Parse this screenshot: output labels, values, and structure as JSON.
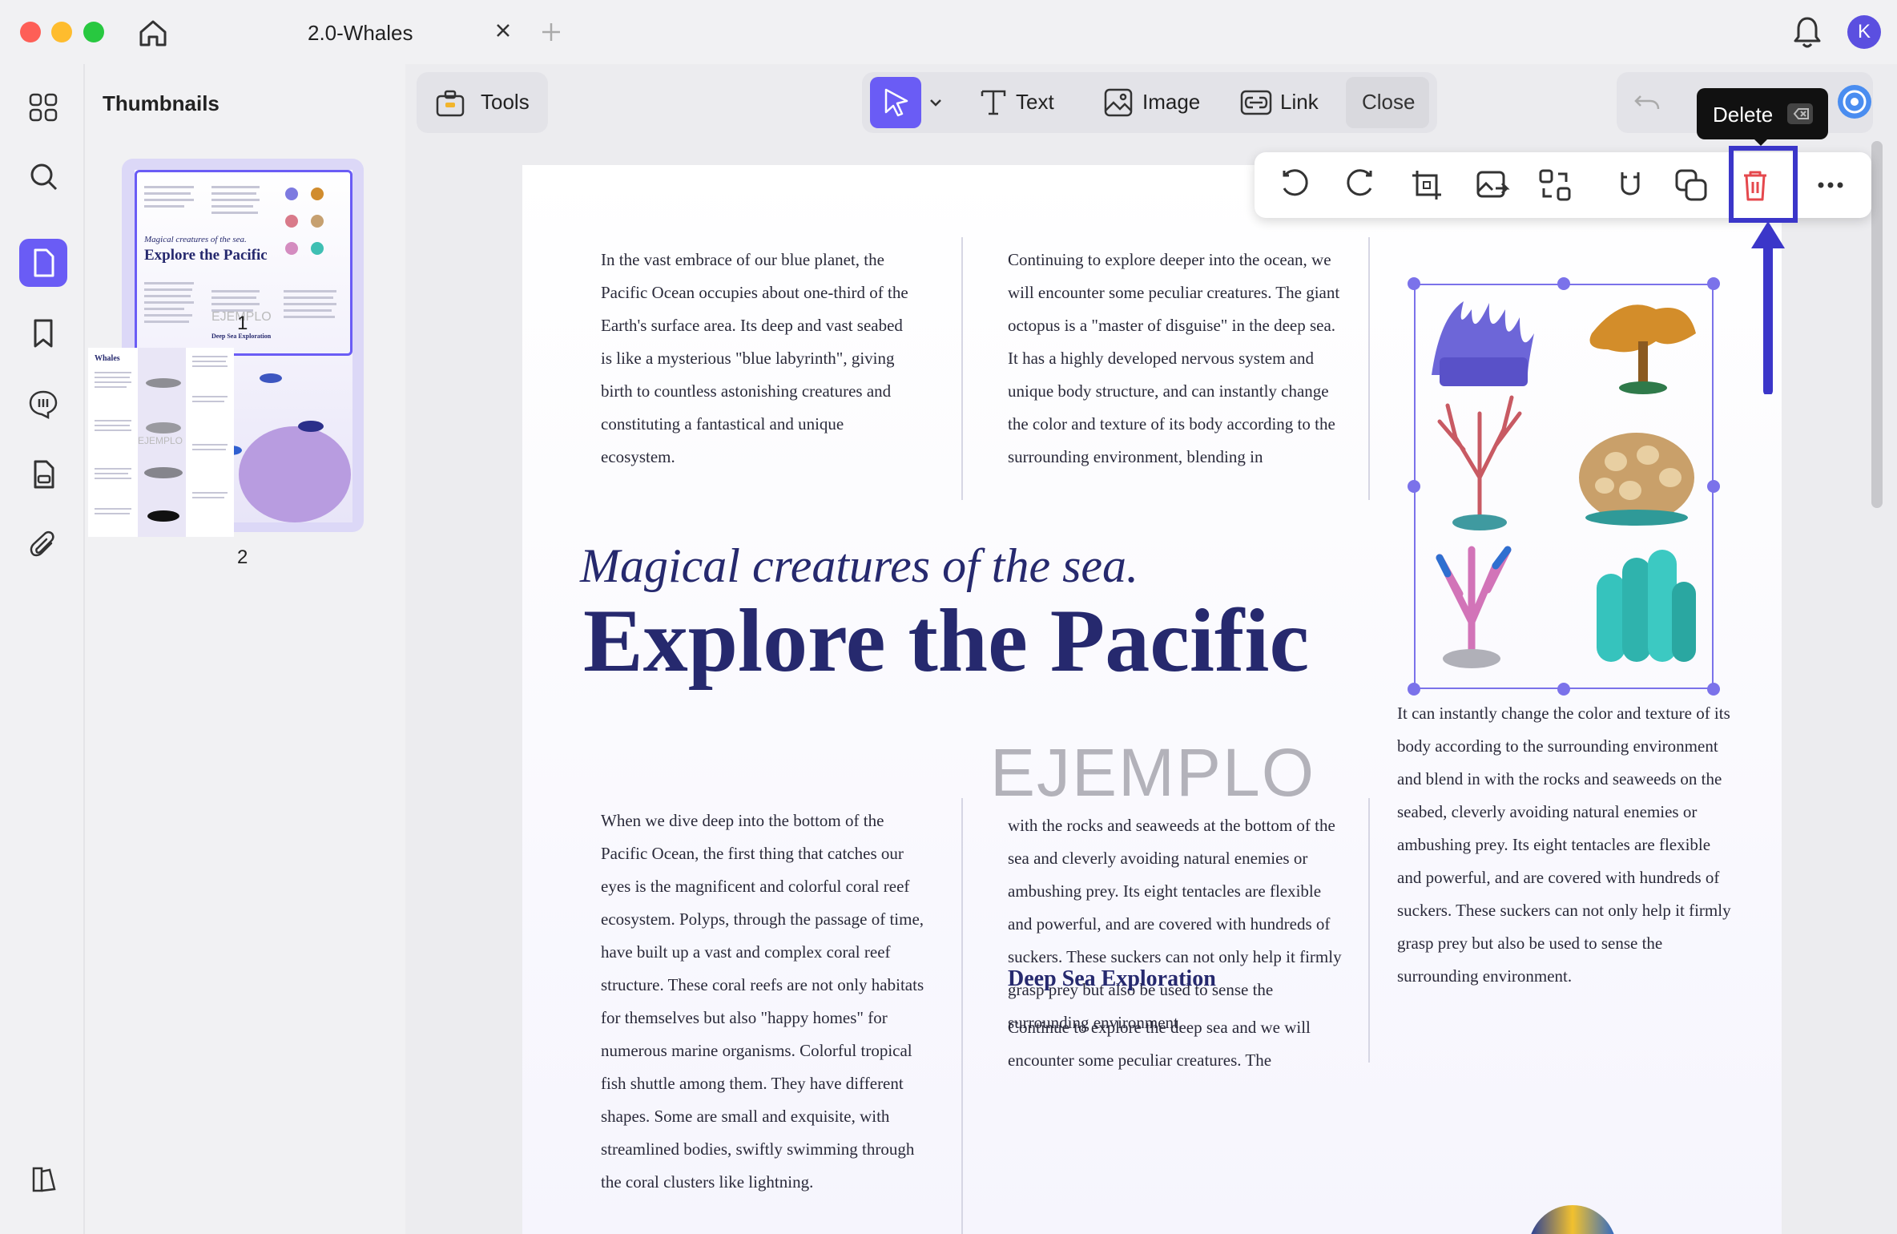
{
  "tab": {
    "title": "2.0-Whales"
  },
  "user": {
    "initial": "K"
  },
  "panel": {
    "title": "Thumbnails",
    "pages": [
      "1",
      "2"
    ]
  },
  "toolbar": {
    "tools_label": "Tools",
    "text_label": "Text",
    "image_label": "Image",
    "link_label": "Link",
    "close_label": "Close"
  },
  "tooltip": {
    "label": "Delete"
  },
  "thumbs": {
    "p1_sub": "Magical creatures of the sea.",
    "p1_title": "Explore the Pacific",
    "p1_h": "Deep Sea Exploration",
    "p1_watermark": "EJEMPLO",
    "p2_title": "Whales",
    "p2_watermark": "EJEMPLO"
  },
  "document": {
    "col1_top": "In the vast embrace of our blue planet, the Pacific Ocean occupies about one-third of the Earth's surface area. Its deep and vast seabed is like a mysterious \"blue labyrinth\", giving birth to countless astonishing creatures and constituting a fantastical and unique ecosystem.",
    "col2_top": "Continuing to explore deeper into the ocean, we will encounter some peculiar creatures. The giant octopus is a \"master of disguise\" in the deep sea. It has a highly developed nervous system and unique body structure, and can instantly change the color and texture of its body according to the surrounding environment, blending in",
    "subtitle": "Magical creatures of the sea.",
    "headline": "Explore the Pacific",
    "col3_mid": "It can instantly change the color and texture of its body according to the surrounding environment and blend in with the rocks and seaweeds on the seabed, cleverly avoiding natural enemies or ambushing prey. Its eight tentacles are flexible and powerful, and are covered with hundreds of suckers. These suckers can not only help it firmly grasp prey but also be used to sense the surrounding environment.",
    "col1_bottom": "When we dive deep into the bottom of the Pacific Ocean, the first thing that catches our eyes is the magnificent and colorful coral reef ecosystem. Polyps, through the passage of time, have built up a vast and complex coral reef structure. These coral reefs are not only habitats for themselves but also \"happy homes\" for numerous marine organisms. Colorful tropical fish shuttle among them. They have different shapes. Some are small and exquisite, with streamlined bodies, swiftly swimming through the coral clusters like lightning.",
    "col2_bottom": "with the rocks and seaweeds at the bottom of the sea and cleverly avoiding natural enemies or ambushing prey. Its eight tentacles are flexible and powerful, and are covered with hundreds of suckers. These suckers can not only help it firmly grasp prey but also be used to sense the surrounding environment.",
    "h3": "Deep Sea Exploration",
    "col2_last": "Continue to explore the deep sea and we will encounter some peculiar creatures. The",
    "watermark": "EJEMPLO"
  },
  "colors": {
    "accent": "#6a5cf5",
    "heading": "#26296e",
    "delete": "#e5484d",
    "highlight": "#3b36c9"
  }
}
